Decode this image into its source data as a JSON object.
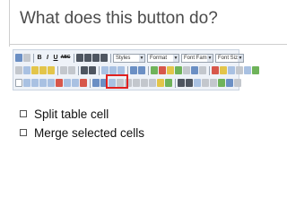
{
  "slide": {
    "title": "What does this button do?"
  },
  "toolbar": {
    "styles_label": "Styles",
    "format_label": "Format",
    "font_family_label": "Font Family",
    "font_size_label": "Font Size",
    "bold": "B",
    "italic": "I",
    "underline": "U",
    "strike": "ABC",
    "highlight_color": "#e0201f"
  },
  "options": [
    {
      "label": "Split table cell"
    },
    {
      "label": "Merge selected cells"
    }
  ]
}
